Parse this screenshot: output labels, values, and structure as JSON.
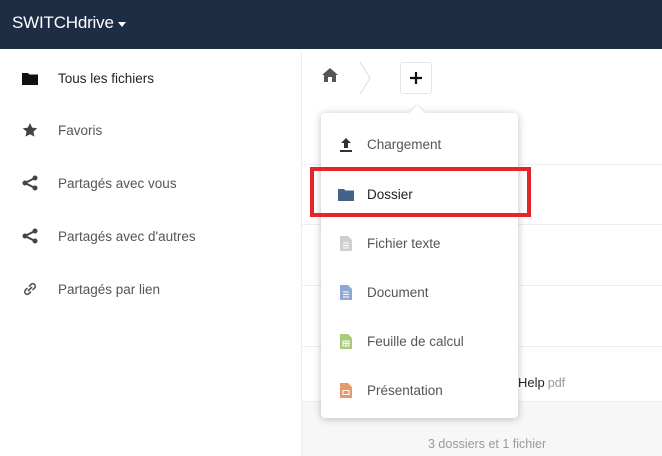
{
  "header": {
    "app_name": "SWITCHdrive",
    "background": "#1d2d44"
  },
  "sidebar": {
    "items": [
      {
        "label": "Tous les fichiers",
        "icon": "folder-icon"
      },
      {
        "label": "Favoris",
        "icon": "star-icon"
      },
      {
        "label": "Partagés avec vous",
        "icon": "share-icon"
      },
      {
        "label": "Partagés avec d'autres",
        "icon": "share-icon"
      },
      {
        "label": "Partagés par lien",
        "icon": "link-icon"
      }
    ]
  },
  "breadcrumb": {
    "home_icon": "home-icon",
    "add_button_label": "+"
  },
  "new_menu": {
    "items": [
      {
        "label": "Chargement",
        "icon": "upload-icon",
        "color": "#555555"
      },
      {
        "label": "Dossier",
        "icon": "folder-icon",
        "color": "#44618a"
      },
      {
        "label": "Fichier texte",
        "icon": "text-file-icon",
        "color": "#cfcfcf"
      },
      {
        "label": "Document",
        "icon": "document-icon",
        "color": "#8ea8d6"
      },
      {
        "label": "Feuille de calcul",
        "icon": "spreadsheet-icon",
        "color": "#a9c97c"
      },
      {
        "label": "Présentation",
        "icon": "presentation-icon",
        "color": "#e69a6a"
      }
    ],
    "highlight_color": "#e3262b"
  },
  "file_list": {
    "visible_name_fragment": "Help",
    "visible_ext": "pdf",
    "summary": "3 dossiers et 1 fichier"
  }
}
